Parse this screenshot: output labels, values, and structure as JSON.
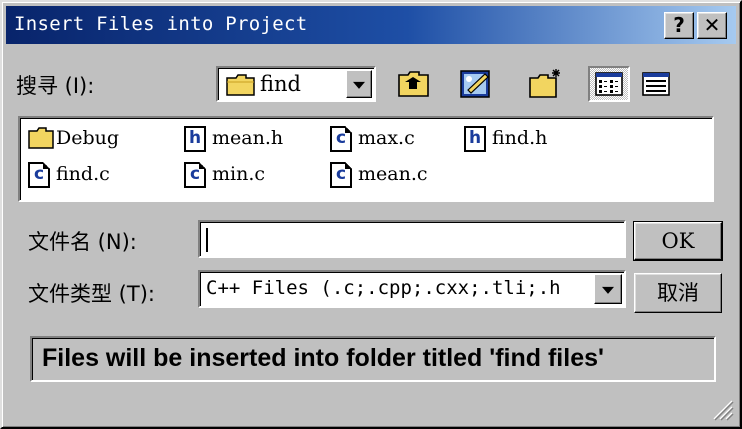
{
  "window": {
    "title": "Insert Files into Project",
    "help_label": "?",
    "close_label": "✕"
  },
  "lookin": {
    "label": "搜寻 (I):",
    "value": "find"
  },
  "toolbar": {
    "icons": [
      "up-folder-icon",
      "desktop-icon",
      "new-folder-icon",
      "list-view-icon",
      "details-view-icon"
    ],
    "active_view": "list-view-icon"
  },
  "files": [
    {
      "name": "Debug",
      "type": "folder"
    },
    {
      "name": "mean.h",
      "type": "h"
    },
    {
      "name": "max.c",
      "type": "c"
    },
    {
      "name": "find.h",
      "type": "h"
    },
    {
      "name": "find.c",
      "type": "c"
    },
    {
      "name": "min.c",
      "type": "c"
    },
    {
      "name": "mean.c",
      "type": "c"
    }
  ],
  "filename": {
    "label": "文件名 (N):",
    "value": ""
  },
  "filetype": {
    "label": "文件类型 (T):",
    "value": "C++ Files (.c;.cpp;.cxx;.tli;.h"
  },
  "buttons": {
    "ok": "OK",
    "cancel": "取消"
  },
  "status": {
    "text": "Files will be inserted into folder titled 'find files'"
  },
  "colors": {
    "title_start": "#08246b",
    "title_end": "#a6caf0",
    "face": "#c0c0c0",
    "icon_letter": "#1a3c9c",
    "folder": "#f2d560"
  }
}
